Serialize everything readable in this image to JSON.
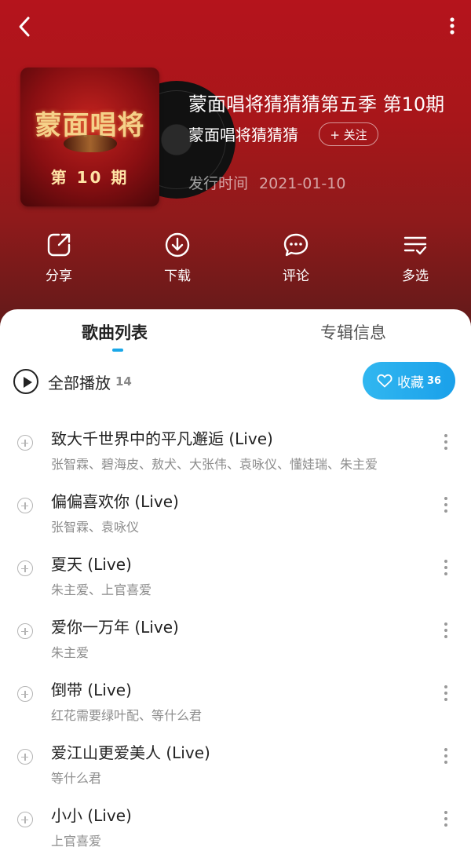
{
  "album": {
    "title": "蒙面唱将猜猜猜第五季 第10期",
    "artist": "蒙面唱将猜猜猜",
    "follow_label": "+ 关注",
    "release_label": "发行时间",
    "release_date": "2021-01-10",
    "cover": {
      "title": "蒙面唱将",
      "subtitle": "第 10 期"
    }
  },
  "actions": [
    {
      "label": "分享",
      "icon": "share-icon"
    },
    {
      "label": "下载",
      "icon": "download-icon"
    },
    {
      "label": "评论",
      "icon": "comment-icon"
    },
    {
      "label": "多选",
      "icon": "multi-select-icon"
    }
  ],
  "tabs": [
    {
      "label": "歌曲列表",
      "active": true
    },
    {
      "label": "专辑信息",
      "active": false
    }
  ],
  "play_all": {
    "label": "全部播放",
    "count": "14"
  },
  "favorite": {
    "label": "收藏",
    "count": "36"
  },
  "songs": [
    {
      "title": "致大千世界中的平凡邂逅 (Live)",
      "artist": "张智霖、碧海皮、敖犬、大张伟、袁咏仪、懂娃瑞、朱主爱"
    },
    {
      "title": "偏偏喜欢你 (Live)",
      "artist": "张智霖、袁咏仪"
    },
    {
      "title": "夏天 (Live)",
      "artist": "朱主爱、上官喜爱"
    },
    {
      "title": "爱你一万年 (Live)",
      "artist": "朱主爱"
    },
    {
      "title": "倒带 (Live)",
      "artist": "红花需要绿叶配、等什么君"
    },
    {
      "title": "爱江山更爱美人 (Live)",
      "artist": "等什么君"
    },
    {
      "title": "小小 (Live)",
      "artist": "上官喜爱"
    }
  ],
  "colors": {
    "header": "#a8161a",
    "accent": "#1aa7e8"
  }
}
